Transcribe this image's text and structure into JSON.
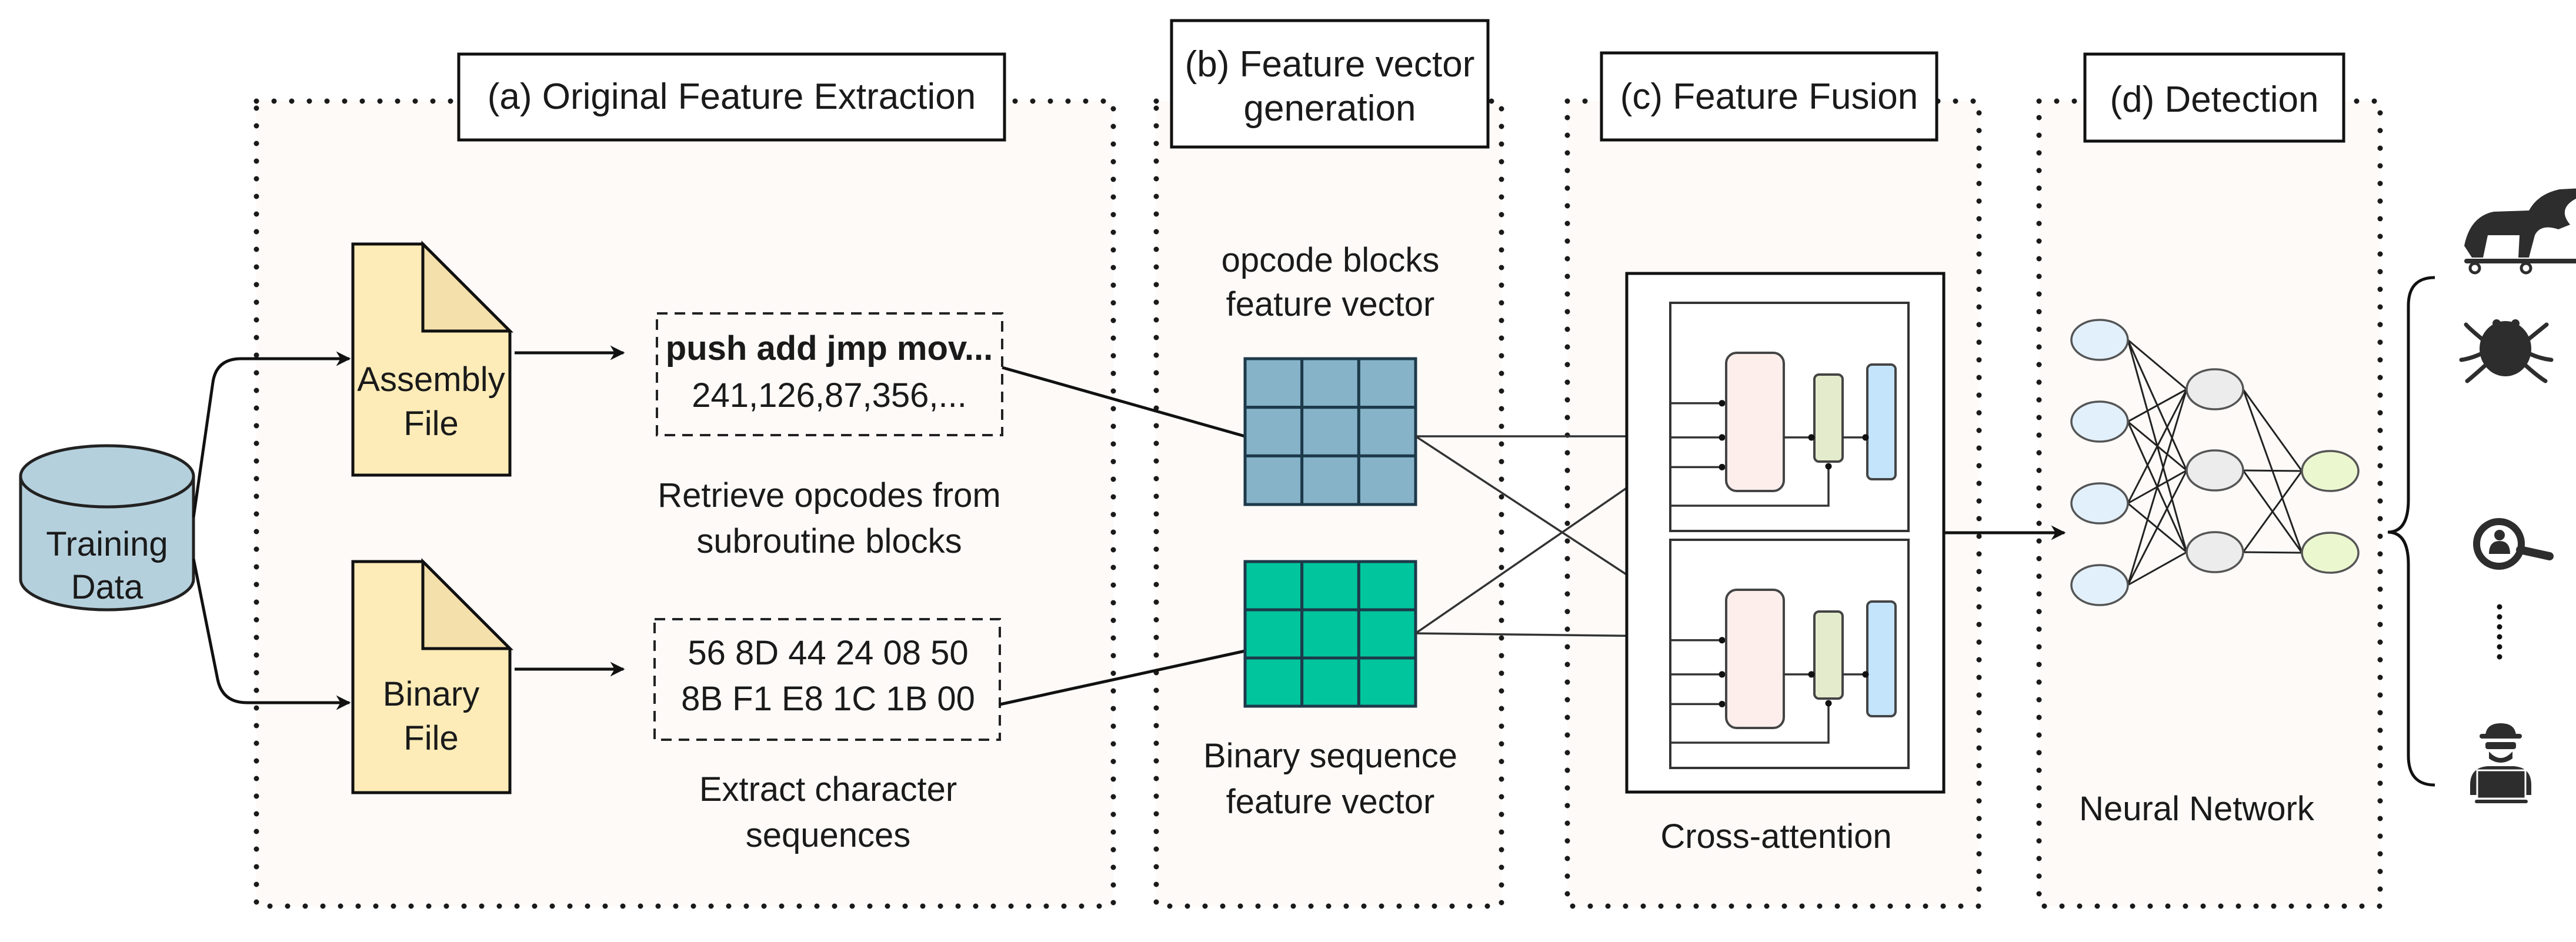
{
  "diagram": {
    "source": {
      "label_lines": [
        "Training",
        "Data"
      ],
      "color": "#b5d0dd"
    },
    "panels": [
      {
        "id": "a",
        "title": "(a) Original Feature Extraction",
        "files": [
          {
            "label_lines": [
              "Assembly",
              "File"
            ],
            "color": "#fdecb8"
          },
          {
            "label_lines": [
              "Binary",
              "File"
            ],
            "color": "#fdecb8"
          }
        ],
        "boxes": [
          {
            "lines": [
              "push add jmp mov...",
              "241,126,87,356,..."
            ],
            "caption_lines": [
              "Retrieve opcodes from",
              "subroutine blocks"
            ]
          },
          {
            "lines": [
              "56 8D 44 24 08 50",
              "8B F1 E8 1C 1B 00"
            ],
            "caption_lines": [
              "Extract character",
              "sequences"
            ]
          }
        ]
      },
      {
        "id": "b",
        "title_lines": [
          "(b) Feature vector",
          "generation"
        ],
        "vectors": [
          {
            "caption_lines": [
              "opcode blocks",
              "feature vector"
            ],
            "color": "#87b3c9",
            "rows": 3,
            "cols": 3
          },
          {
            "caption_lines": [
              "Binary sequence",
              "feature vector"
            ],
            "color": "#00c59d",
            "rows": 3,
            "cols": 3
          }
        ]
      },
      {
        "id": "c",
        "title": "(c) Feature Fusion",
        "caption": "Cross-attention",
        "block_colors": {
          "attention": "#fdeeec",
          "norm": "#e4ebcc",
          "ffn": "#c3e4fb"
        },
        "blocks": 2
      },
      {
        "id": "d",
        "title": "(d) Detection",
        "caption": "Neural Network",
        "network": {
          "layers": [
            4,
            3,
            2
          ],
          "colors": [
            "#e2f0fc",
            "#ececec",
            "#ebf7cf"
          ]
        }
      }
    ],
    "outputs": {
      "icons": [
        "trojan-horse-icon",
        "bug-icon",
        "spyware-icon",
        "ellipsis-icon",
        "hacker-icon"
      ]
    }
  }
}
